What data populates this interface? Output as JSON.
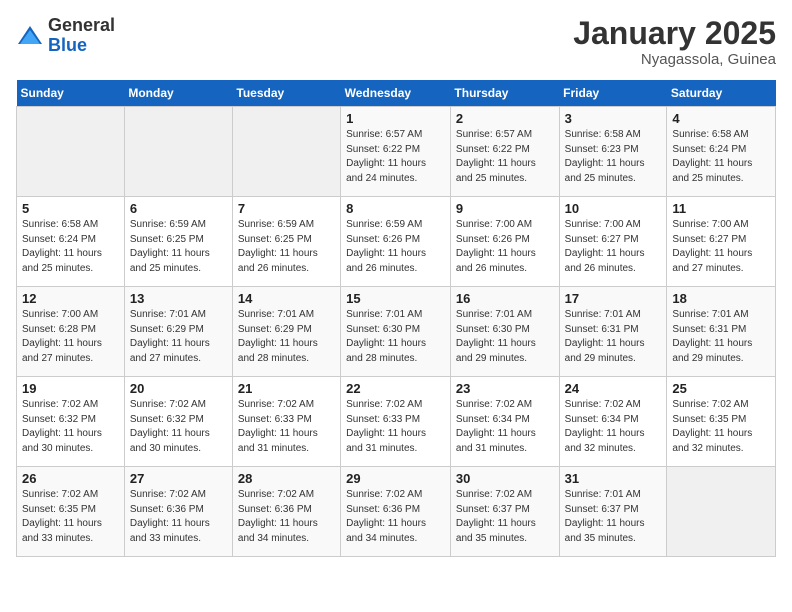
{
  "logo": {
    "general": "General",
    "blue": "Blue"
  },
  "header": {
    "title": "January 2025",
    "subtitle": "Nyagassola, Guinea"
  },
  "days_of_week": [
    "Sunday",
    "Monday",
    "Tuesday",
    "Wednesday",
    "Thursday",
    "Friday",
    "Saturday"
  ],
  "weeks": [
    [
      {
        "day": "",
        "sunrise": "",
        "sunset": "",
        "daylight": ""
      },
      {
        "day": "",
        "sunrise": "",
        "sunset": "",
        "daylight": ""
      },
      {
        "day": "",
        "sunrise": "",
        "sunset": "",
        "daylight": ""
      },
      {
        "day": "1",
        "sunrise": "Sunrise: 6:57 AM",
        "sunset": "Sunset: 6:22 PM",
        "daylight": "Daylight: 11 hours and 24 minutes."
      },
      {
        "day": "2",
        "sunrise": "Sunrise: 6:57 AM",
        "sunset": "Sunset: 6:22 PM",
        "daylight": "Daylight: 11 hours and 25 minutes."
      },
      {
        "day": "3",
        "sunrise": "Sunrise: 6:58 AM",
        "sunset": "Sunset: 6:23 PM",
        "daylight": "Daylight: 11 hours and 25 minutes."
      },
      {
        "day": "4",
        "sunrise": "Sunrise: 6:58 AM",
        "sunset": "Sunset: 6:24 PM",
        "daylight": "Daylight: 11 hours and 25 minutes."
      }
    ],
    [
      {
        "day": "5",
        "sunrise": "Sunrise: 6:58 AM",
        "sunset": "Sunset: 6:24 PM",
        "daylight": "Daylight: 11 hours and 25 minutes."
      },
      {
        "day": "6",
        "sunrise": "Sunrise: 6:59 AM",
        "sunset": "Sunset: 6:25 PM",
        "daylight": "Daylight: 11 hours and 25 minutes."
      },
      {
        "day": "7",
        "sunrise": "Sunrise: 6:59 AM",
        "sunset": "Sunset: 6:25 PM",
        "daylight": "Daylight: 11 hours and 26 minutes."
      },
      {
        "day": "8",
        "sunrise": "Sunrise: 6:59 AM",
        "sunset": "Sunset: 6:26 PM",
        "daylight": "Daylight: 11 hours and 26 minutes."
      },
      {
        "day": "9",
        "sunrise": "Sunrise: 7:00 AM",
        "sunset": "Sunset: 6:26 PM",
        "daylight": "Daylight: 11 hours and 26 minutes."
      },
      {
        "day": "10",
        "sunrise": "Sunrise: 7:00 AM",
        "sunset": "Sunset: 6:27 PM",
        "daylight": "Daylight: 11 hours and 26 minutes."
      },
      {
        "day": "11",
        "sunrise": "Sunrise: 7:00 AM",
        "sunset": "Sunset: 6:27 PM",
        "daylight": "Daylight: 11 hours and 27 minutes."
      }
    ],
    [
      {
        "day": "12",
        "sunrise": "Sunrise: 7:00 AM",
        "sunset": "Sunset: 6:28 PM",
        "daylight": "Daylight: 11 hours and 27 minutes."
      },
      {
        "day": "13",
        "sunrise": "Sunrise: 7:01 AM",
        "sunset": "Sunset: 6:29 PM",
        "daylight": "Daylight: 11 hours and 27 minutes."
      },
      {
        "day": "14",
        "sunrise": "Sunrise: 7:01 AM",
        "sunset": "Sunset: 6:29 PM",
        "daylight": "Daylight: 11 hours and 28 minutes."
      },
      {
        "day": "15",
        "sunrise": "Sunrise: 7:01 AM",
        "sunset": "Sunset: 6:30 PM",
        "daylight": "Daylight: 11 hours and 28 minutes."
      },
      {
        "day": "16",
        "sunrise": "Sunrise: 7:01 AM",
        "sunset": "Sunset: 6:30 PM",
        "daylight": "Daylight: 11 hours and 29 minutes."
      },
      {
        "day": "17",
        "sunrise": "Sunrise: 7:01 AM",
        "sunset": "Sunset: 6:31 PM",
        "daylight": "Daylight: 11 hours and 29 minutes."
      },
      {
        "day": "18",
        "sunrise": "Sunrise: 7:01 AM",
        "sunset": "Sunset: 6:31 PM",
        "daylight": "Daylight: 11 hours and 29 minutes."
      }
    ],
    [
      {
        "day": "19",
        "sunrise": "Sunrise: 7:02 AM",
        "sunset": "Sunset: 6:32 PM",
        "daylight": "Daylight: 11 hours and 30 minutes."
      },
      {
        "day": "20",
        "sunrise": "Sunrise: 7:02 AM",
        "sunset": "Sunset: 6:32 PM",
        "daylight": "Daylight: 11 hours and 30 minutes."
      },
      {
        "day": "21",
        "sunrise": "Sunrise: 7:02 AM",
        "sunset": "Sunset: 6:33 PM",
        "daylight": "Daylight: 11 hours and 31 minutes."
      },
      {
        "day": "22",
        "sunrise": "Sunrise: 7:02 AM",
        "sunset": "Sunset: 6:33 PM",
        "daylight": "Daylight: 11 hours and 31 minutes."
      },
      {
        "day": "23",
        "sunrise": "Sunrise: 7:02 AM",
        "sunset": "Sunset: 6:34 PM",
        "daylight": "Daylight: 11 hours and 31 minutes."
      },
      {
        "day": "24",
        "sunrise": "Sunrise: 7:02 AM",
        "sunset": "Sunset: 6:34 PM",
        "daylight": "Daylight: 11 hours and 32 minutes."
      },
      {
        "day": "25",
        "sunrise": "Sunrise: 7:02 AM",
        "sunset": "Sunset: 6:35 PM",
        "daylight": "Daylight: 11 hours and 32 minutes."
      }
    ],
    [
      {
        "day": "26",
        "sunrise": "Sunrise: 7:02 AM",
        "sunset": "Sunset: 6:35 PM",
        "daylight": "Daylight: 11 hours and 33 minutes."
      },
      {
        "day": "27",
        "sunrise": "Sunrise: 7:02 AM",
        "sunset": "Sunset: 6:36 PM",
        "daylight": "Daylight: 11 hours and 33 minutes."
      },
      {
        "day": "28",
        "sunrise": "Sunrise: 7:02 AM",
        "sunset": "Sunset: 6:36 PM",
        "daylight": "Daylight: 11 hours and 34 minutes."
      },
      {
        "day": "29",
        "sunrise": "Sunrise: 7:02 AM",
        "sunset": "Sunset: 6:36 PM",
        "daylight": "Daylight: 11 hours and 34 minutes."
      },
      {
        "day": "30",
        "sunrise": "Sunrise: 7:02 AM",
        "sunset": "Sunset: 6:37 PM",
        "daylight": "Daylight: 11 hours and 35 minutes."
      },
      {
        "day": "31",
        "sunrise": "Sunrise: 7:01 AM",
        "sunset": "Sunset: 6:37 PM",
        "daylight": "Daylight: 11 hours and 35 minutes."
      },
      {
        "day": "",
        "sunrise": "",
        "sunset": "",
        "daylight": ""
      }
    ]
  ]
}
